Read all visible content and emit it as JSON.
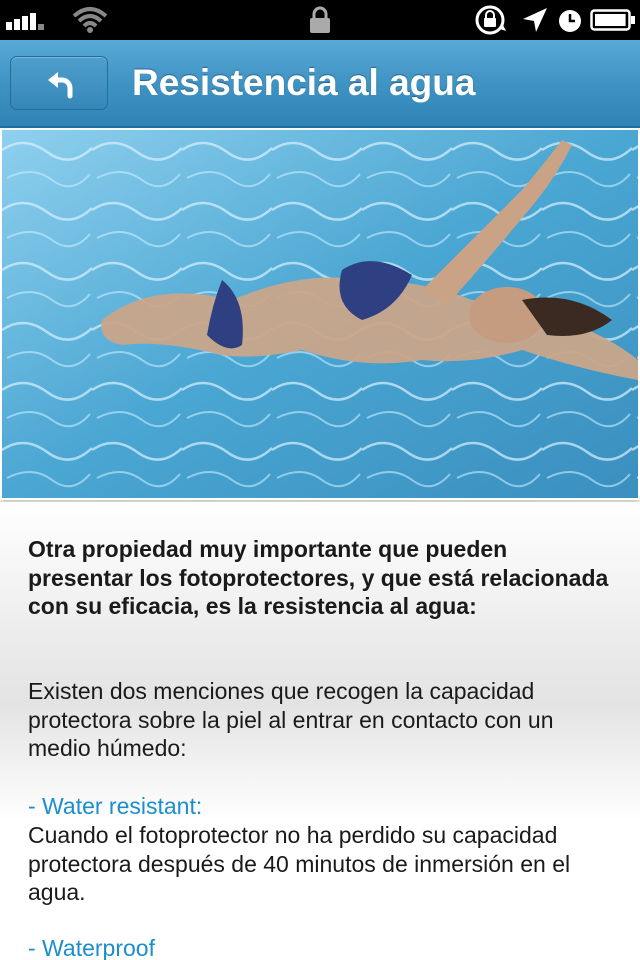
{
  "status_bar": {
    "icons": [
      "signal-bars-icon",
      "wifi-icon",
      "lock-icon",
      "rotation-lock-icon",
      "location-arrow-icon",
      "alarm-clock-icon",
      "battery-icon"
    ],
    "battery_level": 0.9
  },
  "nav": {
    "title": "Resistencia al agua",
    "back_icon": "back-arrow-icon"
  },
  "colors": {
    "nav_bar": "#3f94c4",
    "heading_accent": "#1a8fcc",
    "text": "#1a1a1a"
  },
  "content": {
    "intro_bold": "Otra propiedad muy importante que pueden presentar los fotoprotectores, y que está relacionada con su eficacia, es la resistencia al agua:",
    "intro_text": "Existen dos menciones que recogen la capacidad protectora sobre la piel al entrar en contacto con un medio húmedo:",
    "sections": [
      {
        "heading": "- Water resistant:",
        "text": "Cuando el fotoprotector no ha perdido su capacidad protectora después de 40 minutos de inmersión en el agua."
      },
      {
        "heading": "- Waterproof"
      }
    ]
  }
}
